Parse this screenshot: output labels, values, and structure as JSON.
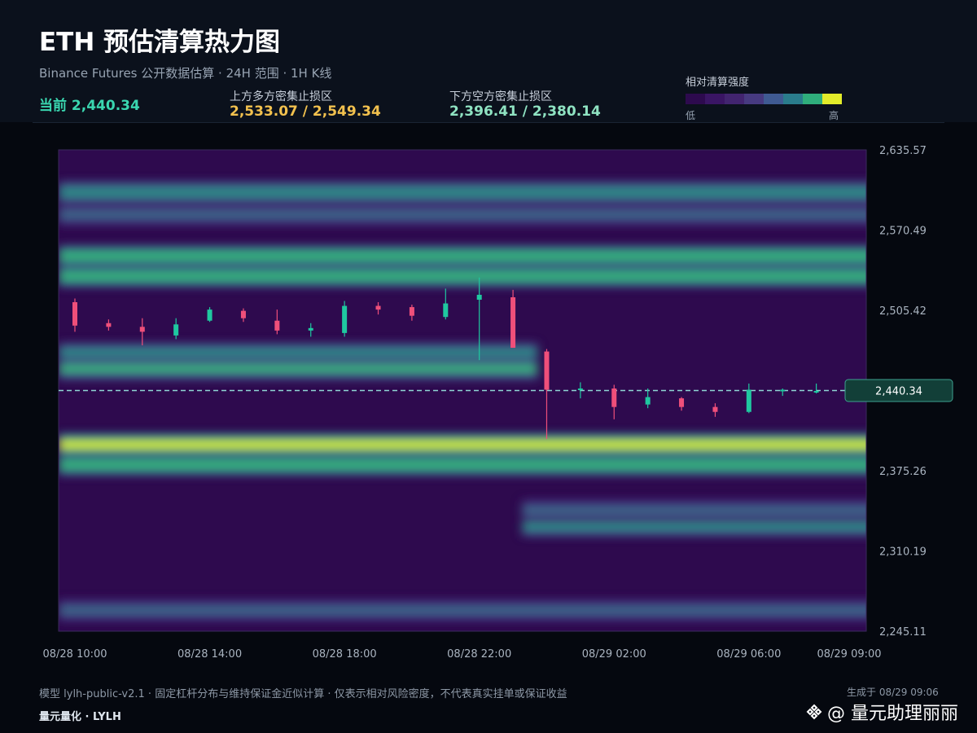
{
  "header": {
    "title": "ETH 预估清算热力图",
    "subtitle": "Binance Futures 公开数据估算 · 24H 范围 · 1H K线",
    "current_label": "当前 2,440.34",
    "upper_zone_label": "上方多方密集止损区",
    "upper_zone_value": "2,533.07 / 2,549.34",
    "lower_zone_label": "下方空方密集止损区",
    "lower_zone_value": "2,396.41 / 2,380.14"
  },
  "legend": {
    "title": "相对清算强度",
    "low": "低",
    "high": "高",
    "colors": [
      "#2d0a4e",
      "#3a1564",
      "#42246f",
      "#473a80",
      "#3f5a92",
      "#2a7c8c",
      "#2fae7c",
      "#e3ec2a"
    ]
  },
  "colors": {
    "up_candle": "#1fc8a0",
    "down_candle": "#ef4f7a",
    "current_line": "#8fd6d4",
    "current_badge_bg": "#123f38",
    "current_badge_border": "#3da08f",
    "accent_current": "#3ad6b0",
    "accent_upper": "#f2c14e",
    "accent_lower": "#8fe3c2"
  },
  "chart_data": {
    "type": "heatmap",
    "title": "ETH 预估清算热力图",
    "xlabel": "",
    "ylabel": "",
    "ylim": [
      2245.11,
      2635.57
    ],
    "xlim": [
      "08/28 10:00",
      "08/29 09:00"
    ],
    "y_ticks": [
      "2,635.57",
      "2,570.49",
      "2,505.42",
      "2,440.34",
      "2,375.26",
      "2,310.19",
      "2,245.11"
    ],
    "x_ticks": [
      "08/28 10:00",
      "08/28 14:00",
      "08/28 18:00",
      "08/28 22:00",
      "08/29 02:00",
      "08/29 06:00",
      "08/29 09:00"
    ],
    "current_price": 2440.34,
    "current_price_label": "2,440.34",
    "candles": [
      {
        "t": "08/28 10:00",
        "o": 2512,
        "h": 2515,
        "l": 2488,
        "c": 2493
      },
      {
        "t": "08/28 11:00",
        "o": 2495,
        "h": 2498,
        "l": 2489,
        "c": 2492
      },
      {
        "t": "08/28 12:00",
        "o": 2492,
        "h": 2499,
        "l": 2477,
        "c": 2488
      },
      {
        "t": "08/28 13:00",
        "o": 2485,
        "h": 2499,
        "l": 2482,
        "c": 2494
      },
      {
        "t": "08/28 14:00",
        "o": 2497,
        "h": 2508,
        "l": 2496,
        "c": 2506
      },
      {
        "t": "08/28 15:00",
        "o": 2505,
        "h": 2507,
        "l": 2496,
        "c": 2499
      },
      {
        "t": "08/28 16:00",
        "o": 2497,
        "h": 2506,
        "l": 2486,
        "c": 2489
      },
      {
        "t": "08/28 17:00",
        "o": 2489,
        "h": 2495,
        "l": 2484,
        "c": 2491
      },
      {
        "t": "08/28 18:00",
        "o": 2487,
        "h": 2513,
        "l": 2484,
        "c": 2509
      },
      {
        "t": "08/28 19:00",
        "o": 2509,
        "h": 2512,
        "l": 2502,
        "c": 2506
      },
      {
        "t": "08/28 20:00",
        "o": 2508,
        "h": 2510,
        "l": 2497,
        "c": 2501
      },
      {
        "t": "08/28 21:00",
        "o": 2500,
        "h": 2523,
        "l": 2498,
        "c": 2511
      },
      {
        "t": "08/28 22:00",
        "o": 2514,
        "h": 2532,
        "l": 2465,
        "c": 2518
      },
      {
        "t": "08/28 23:00",
        "o": 2516,
        "h": 2522,
        "l": 2475,
        "c": 2475
      },
      {
        "t": "08/29 00:00",
        "o": 2472,
        "h": 2474,
        "l": 2401,
        "c": 2441
      },
      {
        "t": "08/29 01:00",
        "o": 2441,
        "h": 2447,
        "l": 2434,
        "c": 2442
      },
      {
        "t": "08/29 02:00",
        "o": 2442,
        "h": 2445,
        "l": 2417,
        "c": 2427
      },
      {
        "t": "08/29 03:00",
        "o": 2429,
        "h": 2442,
        "l": 2426,
        "c": 2435
      },
      {
        "t": "08/29 04:00",
        "o": 2434,
        "h": 2435,
        "l": 2424,
        "c": 2427
      },
      {
        "t": "08/29 05:00",
        "o": 2427,
        "h": 2430,
        "l": 2419,
        "c": 2423
      },
      {
        "t": "08/29 06:00",
        "o": 2423,
        "h": 2446,
        "l": 2422,
        "c": 2441
      },
      {
        "t": "08/29 07:00",
        "o": 2440,
        "h": 2442,
        "l": 2436,
        "c": 2441
      },
      {
        "t": "08/29 08:00",
        "o": 2440,
        "h": 2446,
        "l": 2438,
        "c": 2440
      }
    ],
    "heat_bands": [
      {
        "price": 2601,
        "start": "08/28 10:00",
        "end": "08/29 09:00",
        "intensity": 0.55
      },
      {
        "price": 2583,
        "start": "08/28 10:00",
        "end": "08/29 09:00",
        "intensity": 0.45
      },
      {
        "price": 2549.34,
        "start": "08/28 10:00",
        "end": "08/29 09:00",
        "intensity": 0.72
      },
      {
        "price": 2533.07,
        "start": "08/28 10:00",
        "end": "08/29 09:00",
        "intensity": 0.78
      },
      {
        "price": 2470,
        "start": "08/28 10:00",
        "end": "08/28 23:00",
        "intensity": 0.6
      },
      {
        "price": 2458,
        "start": "08/28 10:00",
        "end": "08/28 23:00",
        "intensity": 0.68
      },
      {
        "price": 2396.41,
        "start": "08/28 10:00",
        "end": "08/29 09:00",
        "intensity": 0.95
      },
      {
        "price": 2380.14,
        "start": "08/28 10:00",
        "end": "08/29 09:00",
        "intensity": 0.75
      },
      {
        "price": 2331,
        "start": "08/29 00:00",
        "end": "08/29 09:00",
        "intensity": 0.55
      },
      {
        "price": 2343,
        "start": "08/29 00:00",
        "end": "08/29 09:00",
        "intensity": 0.45
      },
      {
        "price": 2262,
        "start": "08/28 10:00",
        "end": "08/29 09:00",
        "intensity": 0.4
      }
    ]
  },
  "footer": {
    "note": "模型 lylh-public-v2.1 · 固定杠杆分布与维持保证金近似计算 · 仅表示相对风险密度，不代表真实挂单或保证收益",
    "brand": "量元量化 · LYLH",
    "generated": "生成于 08/29 09:06",
    "watermark": "@ 量元助理丽丽"
  }
}
